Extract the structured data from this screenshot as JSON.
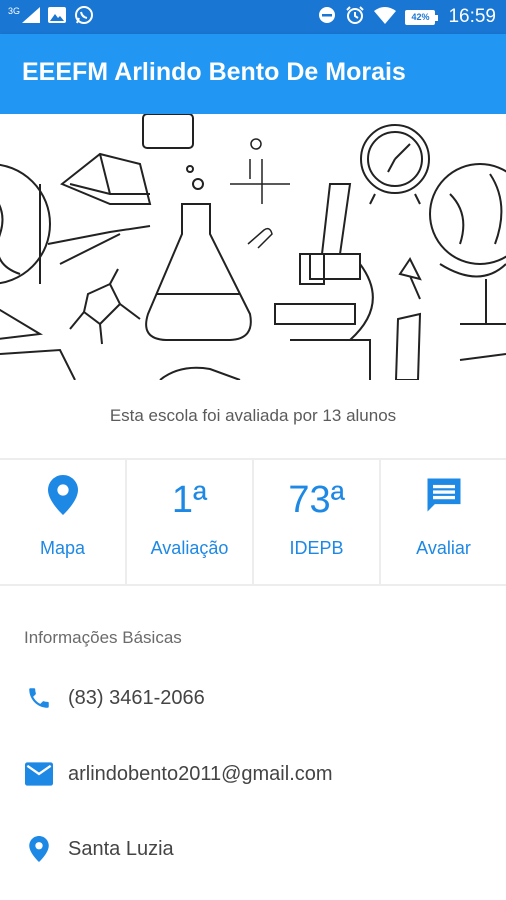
{
  "status_bar": {
    "network_label": "3G",
    "battery": "42%",
    "time": "16:59",
    "icons": [
      "signal-icon",
      "image-icon",
      "whatsapp-icon",
      "do-not-disturb-icon",
      "alarm-icon",
      "wifi-icon",
      "battery-icon"
    ]
  },
  "app_bar": {
    "title": "EEEFM Arlindo Bento De Morais"
  },
  "banner": {
    "illustration": "science-doodles"
  },
  "rating_text": "Esta escola foi avaliada por 13 alunos",
  "stats": {
    "map": {
      "label": "Mapa",
      "icon": "location-pin-icon"
    },
    "evaluation": {
      "value": "1ª",
      "label": "Avaliação"
    },
    "idepb": {
      "value": "73ª",
      "label": "IDEPB"
    },
    "rate": {
      "label": "Avaliar",
      "icon": "comment-icon"
    }
  },
  "info": {
    "title": "Informações Básicas",
    "phone": "(83) 3461-2066",
    "email": "arlindobento2011@gmail.com",
    "city": "Santa Luzia"
  },
  "colors": {
    "primary": "#2196f3",
    "primary_dark": "#1976d2",
    "accent_text": "#1e88e5"
  }
}
